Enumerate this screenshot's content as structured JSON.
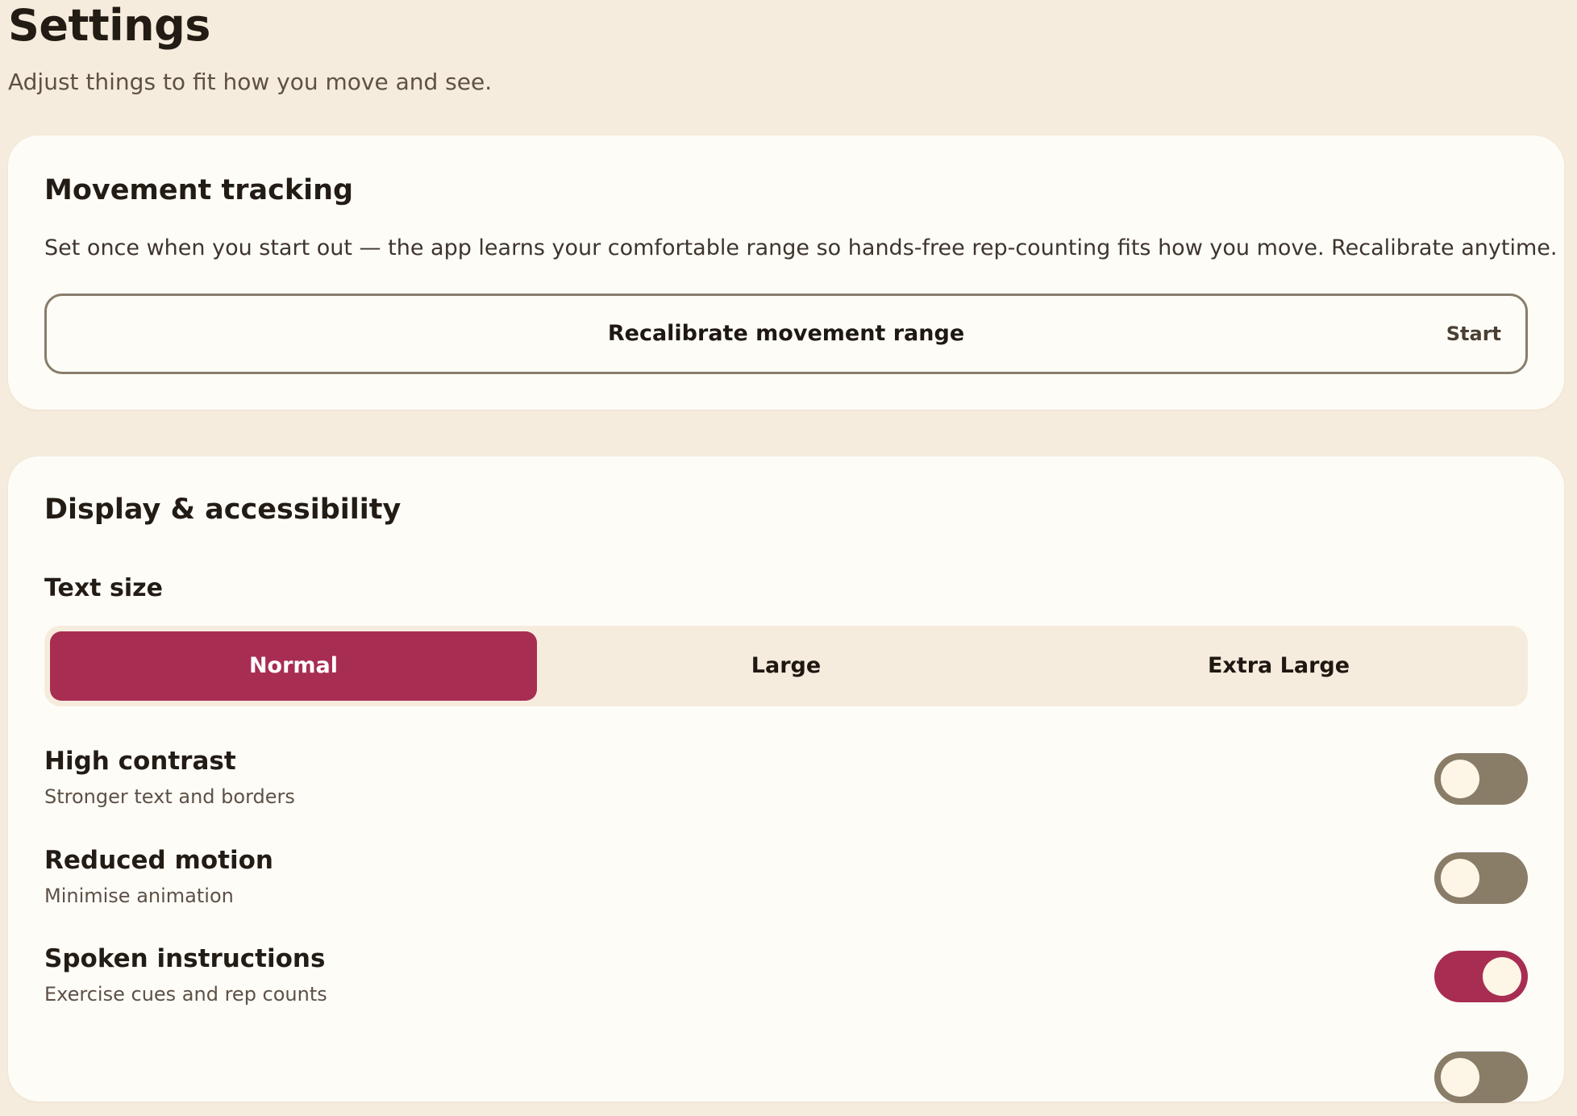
{
  "header": {
    "title": "Settings",
    "subtitle": "Adjust things to fit how you move and see."
  },
  "movement_tracking": {
    "title": "Movement tracking",
    "description": "Set once when you start out — the app learns your comfortable range so hands-free rep-counting fits how you move. Recalibrate anytime.",
    "recalibrate_label": "Recalibrate movement range",
    "recalibrate_action": "Start"
  },
  "display": {
    "title": "Display & accessibility",
    "text_size": {
      "label": "Text size",
      "options": [
        "Normal",
        "Large",
        "Extra Large"
      ],
      "selected": "Normal"
    },
    "toggles": [
      {
        "title": "High contrast",
        "subtitle": "Stronger text and borders",
        "on": false
      },
      {
        "title": "Reduced motion",
        "subtitle": "Minimise animation",
        "on": false
      },
      {
        "title": "Spoken instructions",
        "subtitle": "Exercise cues and rep counts",
        "on": true
      }
    ]
  },
  "colors": {
    "background": "#f6ecdd",
    "card": "#fefcf7",
    "accent": "#a82d53",
    "toggle_off": "#8a7d68"
  }
}
